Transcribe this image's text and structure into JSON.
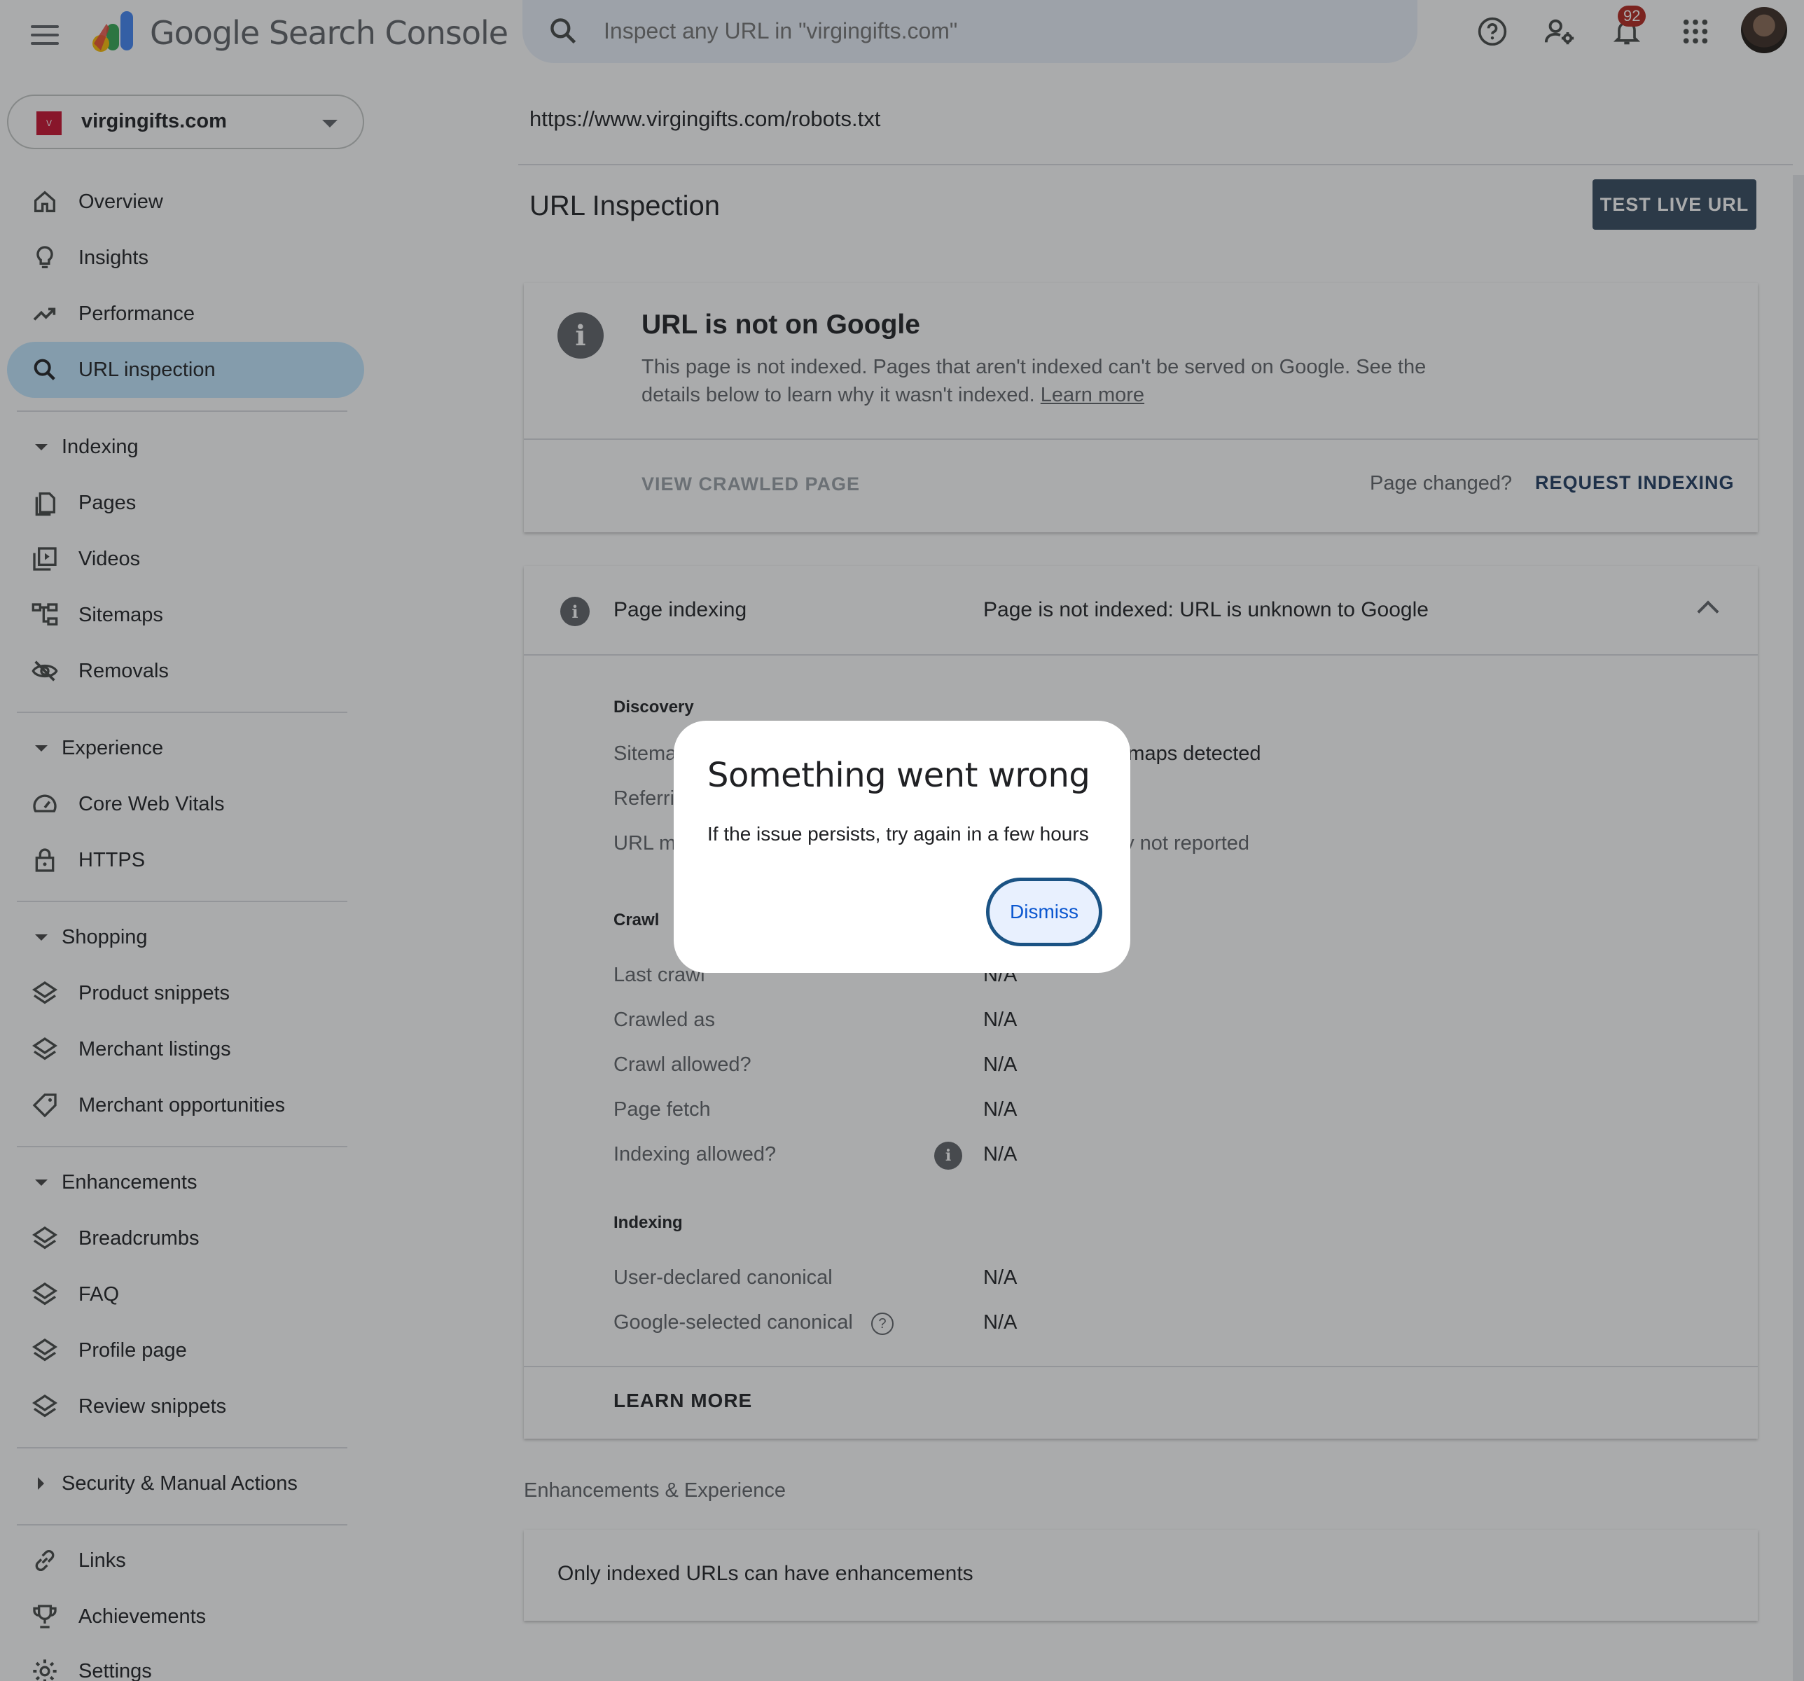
{
  "app": {
    "brand": "Google Search Console",
    "search_placeholder": "Inspect any URL in \"virgingifts.com\"",
    "notification_count": "92"
  },
  "sidebar": {
    "property": "virgingifts.com",
    "items": [
      {
        "label": "Overview",
        "icon": "home-icon"
      },
      {
        "label": "Insights",
        "icon": "lightbulb-icon"
      },
      {
        "label": "Performance",
        "icon": "trending-up-icon"
      },
      {
        "label": "URL inspection",
        "icon": "search-icon",
        "active": true
      }
    ],
    "sections": {
      "indexing": {
        "label": "Indexing",
        "items": [
          "Pages",
          "Videos",
          "Sitemaps",
          "Removals"
        ]
      },
      "experience": {
        "label": "Experience",
        "items": [
          "Core Web Vitals",
          "HTTPS"
        ]
      },
      "shopping": {
        "label": "Shopping",
        "items": [
          "Product snippets",
          "Merchant listings",
          "Merchant opportunities"
        ]
      },
      "enhancements": {
        "label": "Enhancements",
        "items": [
          "Breadcrumbs",
          "FAQ",
          "Profile page",
          "Review snippets"
        ]
      },
      "security": {
        "label": "Security & Manual Actions"
      }
    },
    "bottom": [
      "Links",
      "Achievements",
      "Settings"
    ]
  },
  "main": {
    "url": "https://www.virgingifts.com/robots.txt",
    "title": "URL Inspection",
    "test_live_url": "TEST LIVE URL",
    "status_card": {
      "heading": "URL is not on Google",
      "body": "This page is not indexed. Pages that aren't indexed can't be served on Google. See the details below to learn why it wasn't indexed.",
      "learn_more": "Learn more",
      "view_crawled": "VIEW CRAWLED PAGE",
      "page_changed": "Page changed?",
      "request_indexing": "REQUEST INDEXING"
    },
    "indexing_card": {
      "label": "Page indexing",
      "value": "Page is not indexed: URL is unknown to Google",
      "discovery": "Discovery",
      "sitemaps_k": "Sitemaps",
      "sitemaps_v": "No referring sitemaps detected",
      "referring_k": "Referring page",
      "url_might_k": "URL might be known from other sources that are currently not reported",
      "url_might_v": "tly not reported",
      "crawl": "Crawl",
      "rows_crawl": [
        {
          "k": "Last crawl",
          "v": "N/A"
        },
        {
          "k": "Crawled as",
          "v": "N/A"
        },
        {
          "k": "Crawl allowed?",
          "v": "N/A"
        },
        {
          "k": "Page fetch",
          "v": "N/A"
        },
        {
          "k": "Indexing allowed?",
          "v": "N/A"
        }
      ],
      "indexing": "Indexing",
      "rows_index": [
        {
          "k": "User-declared canonical",
          "v": "N/A"
        },
        {
          "k": "Google-selected canonical",
          "v": "N/A"
        }
      ],
      "learn_more": "LEARN MORE"
    },
    "enhancements_title": "Enhancements & Experience",
    "enhancements_text": "Only indexed URLs can have enhancements"
  },
  "dialog": {
    "title": "Something went wrong",
    "message": "If the issue persists, try again in a few hours",
    "dismiss": "Dismiss"
  }
}
